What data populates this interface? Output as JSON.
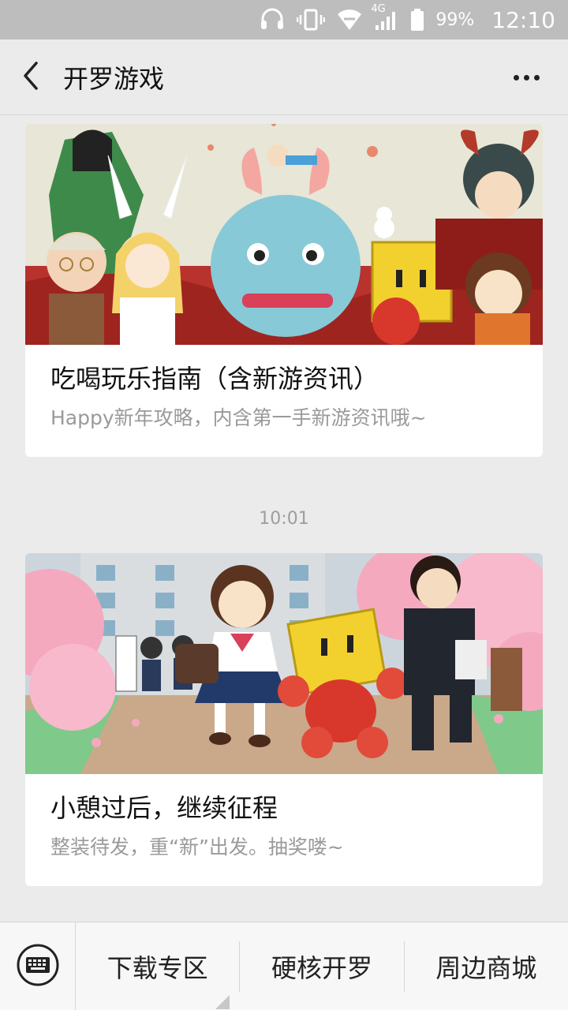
{
  "status_bar": {
    "battery": "99%",
    "time": "12:10",
    "network": "4G",
    "icons": [
      "headset-icon",
      "vibrate-icon",
      "wifi-icon",
      "signal-icon",
      "battery-icon"
    ]
  },
  "header": {
    "title": "开罗游戏",
    "icons": {
      "back": "back-arrow-icon",
      "more": "more-dots-icon"
    }
  },
  "feed": {
    "articles": [
      {
        "title": "吃喝玩乐指南（含新游资讯）",
        "subtitle": "Happy新年攻略，内含第一手新游资讯哦~"
      },
      {
        "title": "小憩过后，继续征程",
        "subtitle": "整装待发，重“新”出发。抽奖喽~"
      }
    ],
    "timestamp": "10:01"
  },
  "menu": {
    "items": [
      "下载专区",
      "硬核开罗",
      "周边商城"
    ],
    "keyboard_icon": "keyboard-icon"
  },
  "colors": {
    "background": "#ebebeb",
    "status_bar": "#bdbdbd",
    "subtitle": "#9a9a9a"
  }
}
